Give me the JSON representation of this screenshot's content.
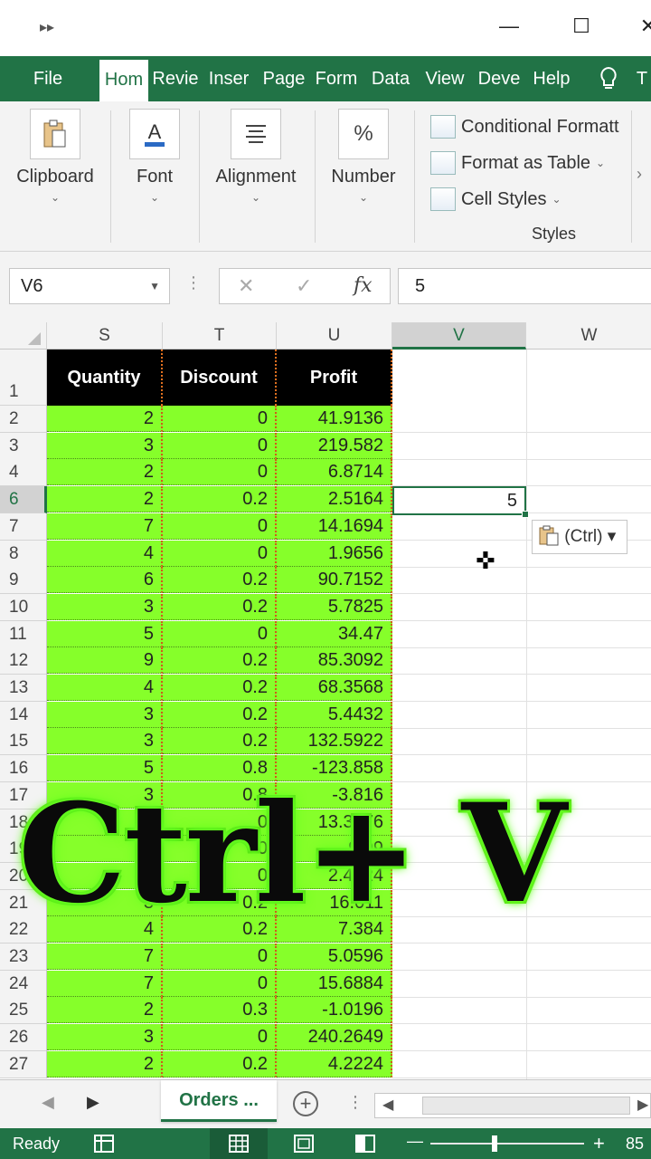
{
  "titlebar": {
    "qat_icon": "more-commands-icon",
    "minimize": "—",
    "maximize": "☐",
    "close": "✕"
  },
  "tabs": [
    "File",
    "Hom",
    "Revie",
    "Inser",
    "Page",
    "Form",
    "Data",
    "View",
    "Deve",
    "Help",
    "T"
  ],
  "tabs_selected": "Hom",
  "tell_me_icon": "lightbulb-icon",
  "ribbon": {
    "clipboard": "Clipboard",
    "font": "Font",
    "alignment": "Alignment",
    "number": "Number",
    "number_icon": "%",
    "conditional": "Conditional Formatt",
    "format_table": "Format as Table",
    "cell_styles": "Cell Styles",
    "styles_group": "Styles",
    "caret": "⌄"
  },
  "formula_bar": {
    "name_box": "V6",
    "cancel": "✕",
    "enter": "✓",
    "fx": "fx",
    "content": "5"
  },
  "columns": [
    "S",
    "T",
    "U",
    "V",
    "W"
  ],
  "active_column": "V",
  "header_row": {
    "row_number": "1",
    "cells": [
      "Quantity",
      "Discount",
      "Profit"
    ]
  },
  "rows": [
    {
      "n": "2",
      "q": "2",
      "d": "0",
      "p": "41.9136"
    },
    {
      "n": "3",
      "q": "3",
      "d": "0",
      "p": "219.582"
    },
    {
      "n": "4",
      "q": "2",
      "d": "0",
      "p": "6.8714"
    },
    {
      "n": "6",
      "q": "2",
      "d": "0.2",
      "p": "2.5164"
    },
    {
      "n": "7",
      "q": "7",
      "d": "0",
      "p": "14.1694"
    },
    {
      "n": "8",
      "q": "4",
      "d": "0",
      "p": "1.9656"
    },
    {
      "n": "9",
      "q": "6",
      "d": "0.2",
      "p": "90.7152"
    },
    {
      "n": "10",
      "q": "3",
      "d": "0.2",
      "p": "5.7825"
    },
    {
      "n": "11",
      "q": "5",
      "d": "0",
      "p": "34.47"
    },
    {
      "n": "12",
      "q": "9",
      "d": "0.2",
      "p": "85.3092"
    },
    {
      "n": "13",
      "q": "4",
      "d": "0.2",
      "p": "68.3568"
    },
    {
      "n": "14",
      "q": "3",
      "d": "0.2",
      "p": "5.4432"
    },
    {
      "n": "15",
      "q": "3",
      "d": "0.2",
      "p": "132.5922"
    },
    {
      "n": "16",
      "q": "5",
      "d": "0.8",
      "p": "-123.858"
    },
    {
      "n": "17",
      "q": "3",
      "d": "0.8",
      "p": "-3.816"
    },
    {
      "n": "18",
      "q": "6",
      "d": "0",
      "p": "13.3176"
    },
    {
      "n": "19",
      "q": "1",
      "d": "0",
      "p": "9.99"
    },
    {
      "n": "20",
      "q": "2",
      "d": "0",
      "p": "2.4824"
    },
    {
      "n": "21",
      "q": "3",
      "d": "0.2",
      "p": "16.011"
    },
    {
      "n": "22",
      "q": "4",
      "d": "0.2",
      "p": "7.384"
    },
    {
      "n": "23",
      "q": "7",
      "d": "0",
      "p": "5.0596"
    },
    {
      "n": "24",
      "q": "7",
      "d": "0",
      "p": "15.6884"
    },
    {
      "n": "25",
      "q": "2",
      "d": "0.3",
      "p": "-1.0196"
    },
    {
      "n": "26",
      "q": "3",
      "d": "0",
      "p": "240.2649"
    },
    {
      "n": "27",
      "q": "2",
      "d": "0.2",
      "p": "4.2224"
    }
  ],
  "active_row": "6",
  "selected_cell_value": "5",
  "paste_options": "(Ctrl)",
  "paste_options_caret": "▾",
  "overlay_text": "Ctrl+ V",
  "sheet_tabs": {
    "prev": "◀",
    "next": "▶",
    "active": "Orders ...",
    "add": "+",
    "dots": "⋮"
  },
  "status": {
    "ready": "Ready",
    "zoom": "85",
    "zoom_minus": "—",
    "zoom_plus": "+"
  },
  "colors": {
    "excel_green": "#217346",
    "cell_fill": "#86ff2a",
    "header_fill": "#000000",
    "overlay_glow": "#66ff22"
  }
}
